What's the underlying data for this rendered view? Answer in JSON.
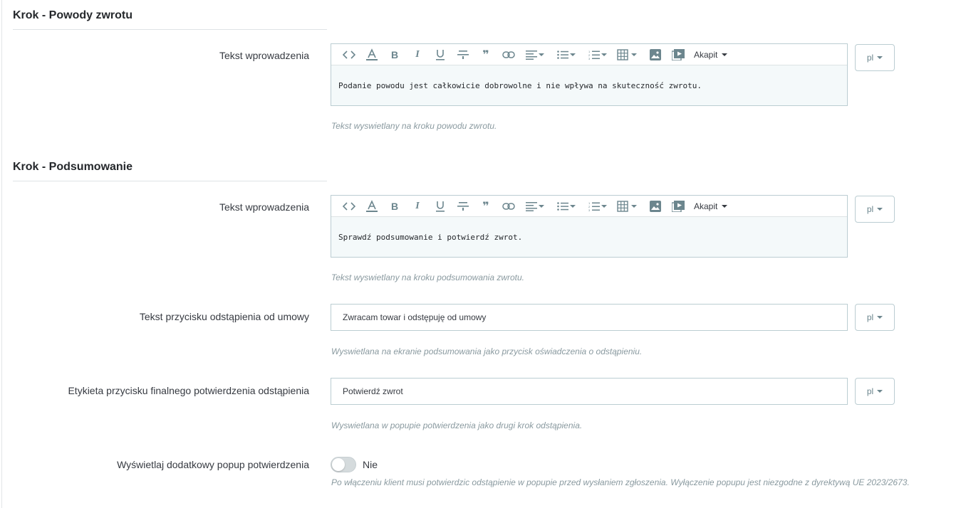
{
  "sections": [
    {
      "title": "Krok - Powody zwrotu",
      "field": {
        "label": "Tekst wprowadzenia",
        "content": "Podanie powodu jest całkowicie dobrowolne i nie wpływa na skuteczność zwrotu.",
        "lang": "pl",
        "help": "Tekst wyswietlany na kroku powodu zwrotu."
      }
    },
    {
      "title": "Krok - Podsumowanie",
      "field": {
        "label": "Tekst wprowadzenia",
        "content": "Sprawdź podsumowanie i potwierdź zwrot.",
        "lang": "pl",
        "help": "Tekst wyswietlany na kroku podsumowania zwrotu."
      }
    }
  ],
  "toolbar": {
    "format_label": "Akapit",
    "icons": [
      "code-icon",
      "text-color-icon",
      "bold-icon",
      "italic-icon",
      "underline-icon",
      "strikethrough-icon",
      "blockquote-icon",
      "link-icon",
      "align-icon",
      "bulleted-list-icon",
      "numbered-list-icon",
      "table-icon",
      "image-icon",
      "media-icon"
    ]
  },
  "withdrawal_button": {
    "label": "Tekst przycisku odstąpienia od umowy",
    "value": "Zwracam towar i odstępuję od umowy",
    "lang": "pl",
    "help": "Wyswietlana na ekranie podsumowania jako przycisk oświadczenia o odstąpieniu."
  },
  "final_confirm": {
    "label": "Etykieta przycisku finalnego potwierdzenia odstąpienia",
    "value": "Potwierdź zwrot",
    "lang": "pl",
    "help": "Wyswietlana w popupie potwierdzenia jako drugi krok odstąpienia."
  },
  "popup_toggle": {
    "label": "Wyświetlaj dodatkowy popup potwierdzenia",
    "state_label": "Nie",
    "enabled": false,
    "help": "Po włączeniu klient musi potwierdzic odstąpienie w popupie przed wysłaniem zgłoszenia. Wyłączenie popupu jest niezgodne z dyrektywą UE 2023/2673."
  },
  "colors": {
    "border": "#bbcdd2",
    "editor_bg": "#f4f9fa",
    "icon": "#6c868e",
    "help_text": "#8a9aa0"
  }
}
